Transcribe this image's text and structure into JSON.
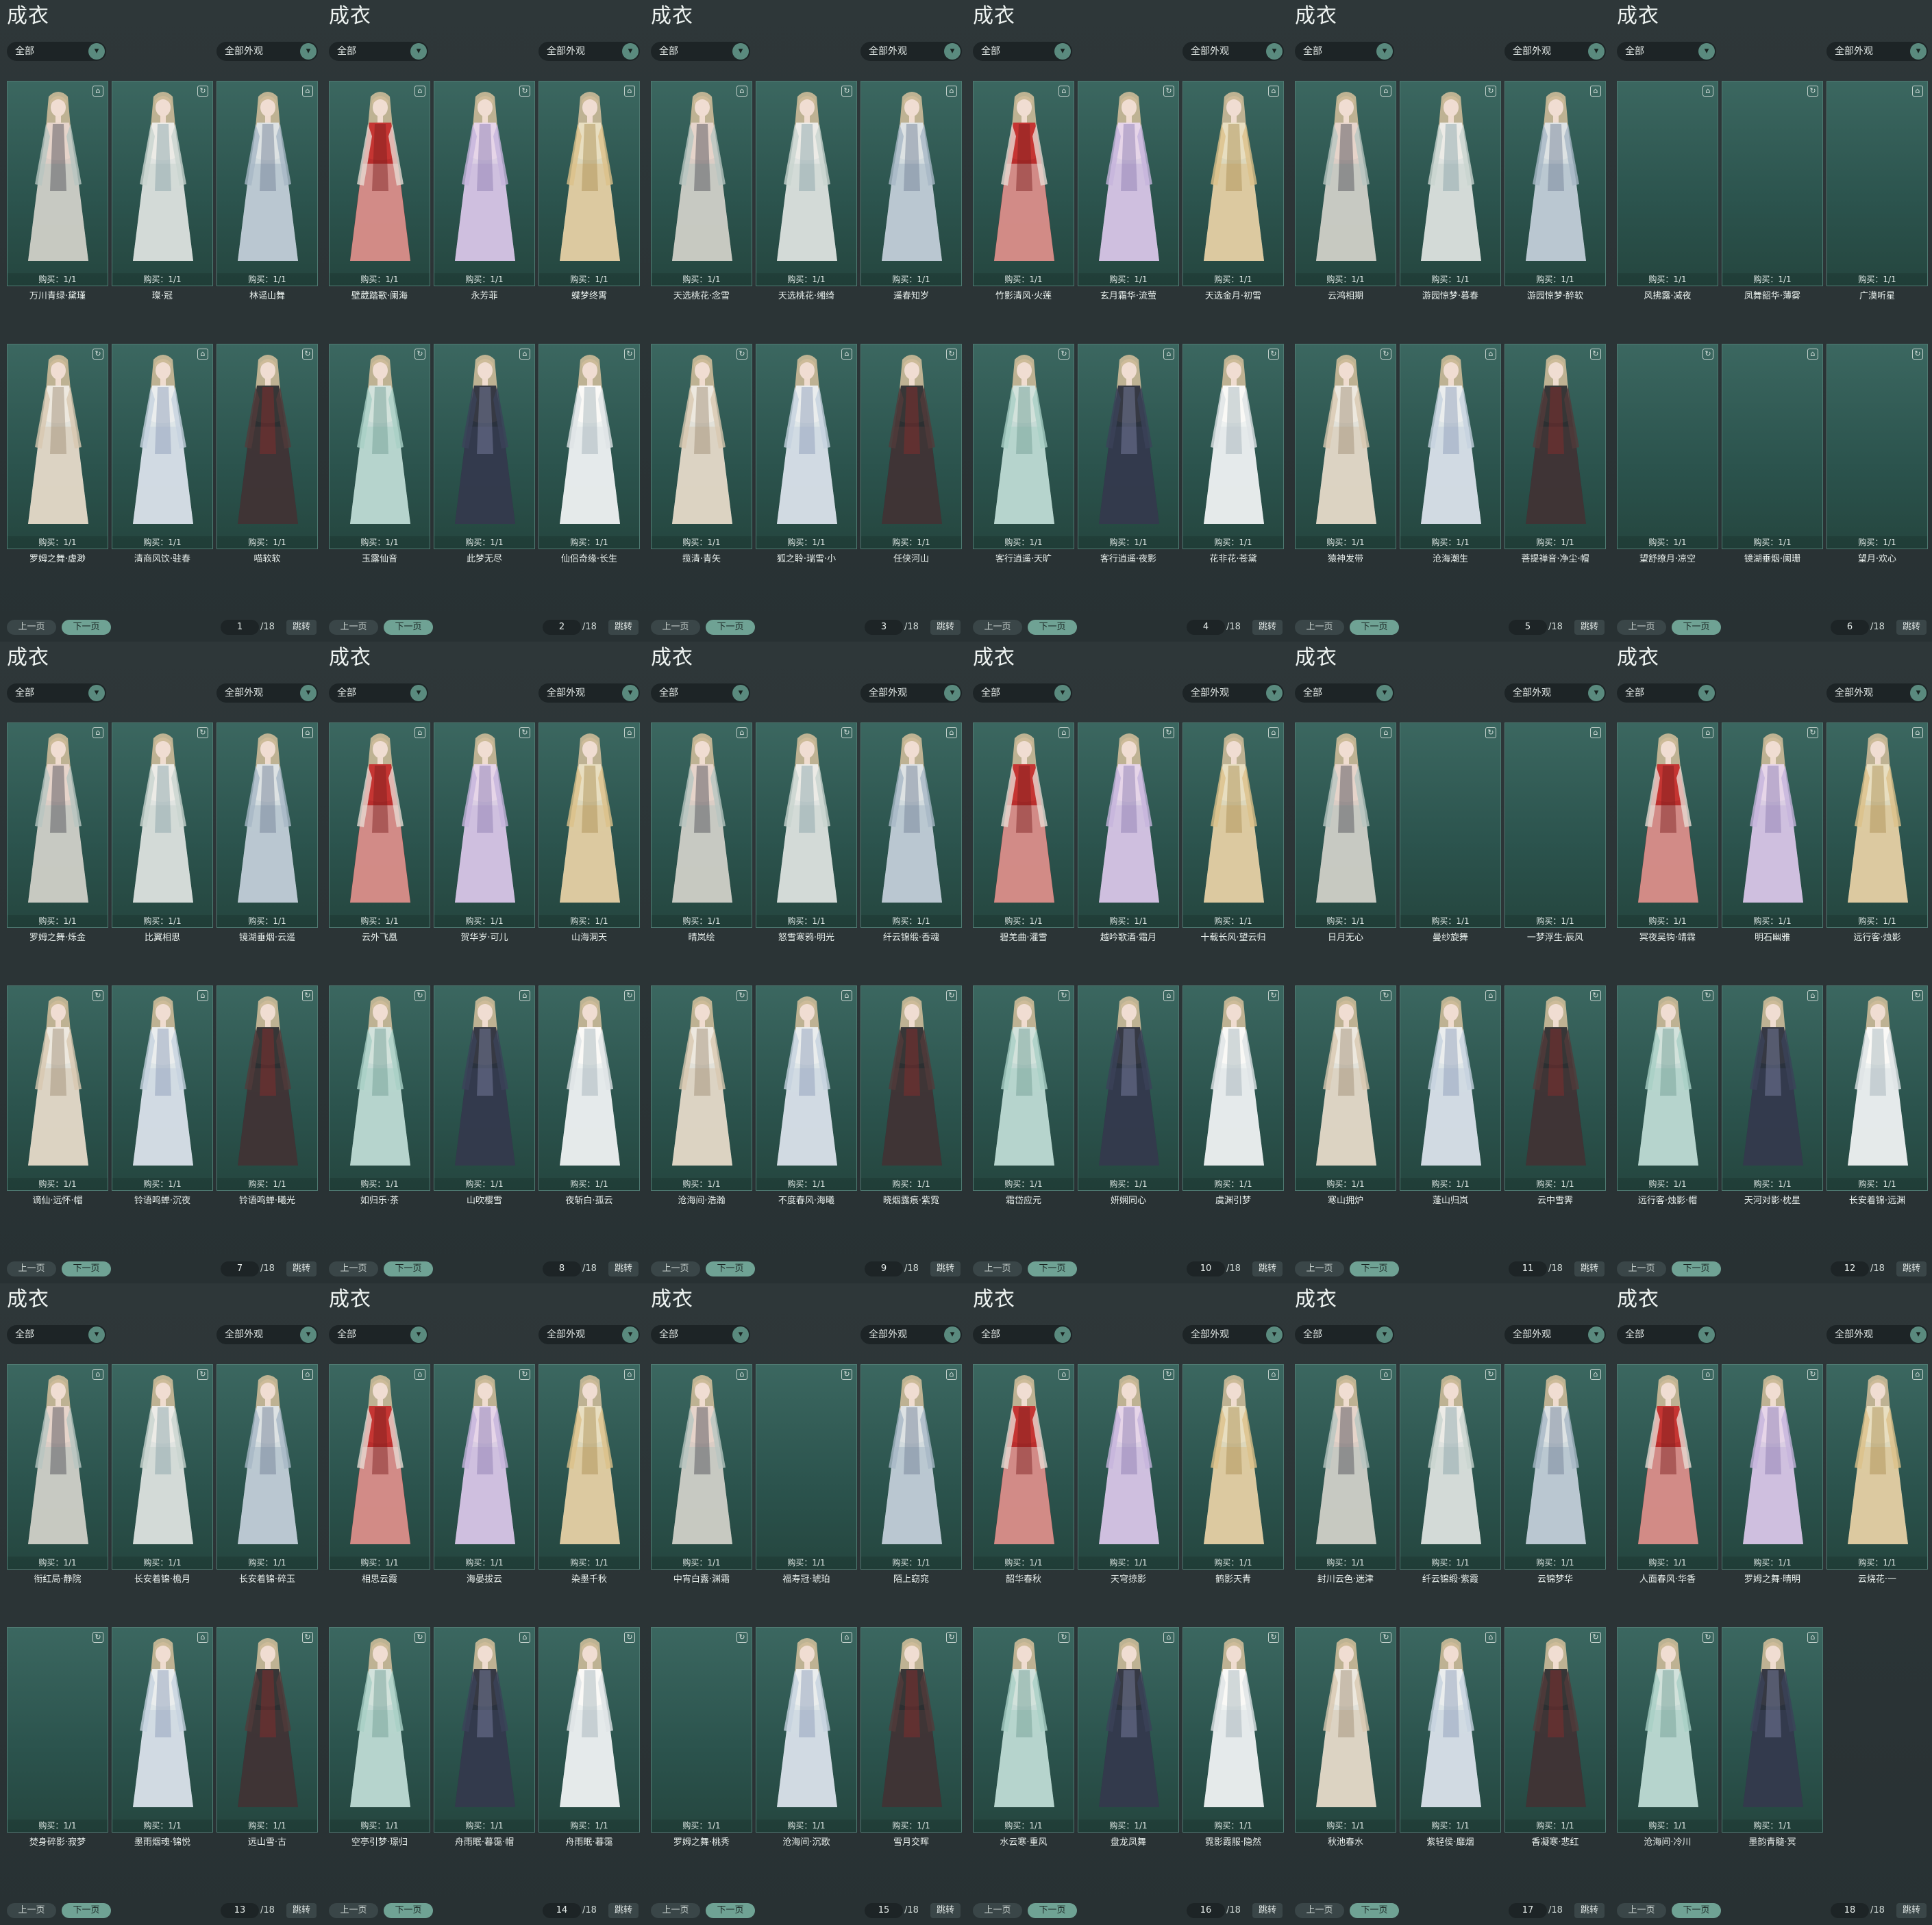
{
  "ui": {
    "title": "成衣",
    "filter_left": "全部",
    "filter_right": "全部外观",
    "prev_label": "上一页",
    "next_label": "下一页",
    "total_pages": "/18",
    "jump_label": "跳转",
    "buy_label": "购买：1/1"
  },
  "colors": {
    "background": "#2b3336",
    "card": "#2f5a54",
    "accent": "#6fa294"
  },
  "pages": [
    {
      "page": "1",
      "items": [
        "万川青绿·黛瑾",
        "璨·冠",
        "林谣山舞",
        "罗姆之舞·虚渺",
        "清商风饮·驻春",
        "喵软软"
      ]
    },
    {
      "page": "2",
      "items": [
        "壁葳踏歌·阑海",
        "永芳菲",
        "蝶梦终霄",
        "玉露仙音",
        "此梦无尽",
        "仙侣奇缘·长生"
      ]
    },
    {
      "page": "3",
      "items": [
        "天选桃花·念雪",
        "天选桃花·缃绮",
        "遥春知岁",
        "揽清·青矢",
        "狐之聆·瑞雪·小",
        "任侠河山"
      ]
    },
    {
      "page": "4",
      "items": [
        "竹影清风·火莲",
        "玄月霜华·流萤",
        "天选金月·初雪",
        "客行逍遥·天旷",
        "客行逍遥·夜影",
        "花非花·苍黛"
      ]
    },
    {
      "page": "5",
      "items": [
        "云鸿相期",
        "游园惊梦·暮春",
        "游园惊梦·醉软",
        "猿神发带",
        "沧海潮生",
        "菩提禅音·净尘·帽"
      ]
    },
    {
      "page": "6",
      "items": [
        "风拂露·减夜",
        "凤舞韶华·薄雾",
        "广漠听星",
        "望舒撩月·凉空",
        "镜湖垂烟·阑珊",
        "望月·欢心"
      ]
    },
    {
      "page": "7",
      "items": [
        "罗姆之舞·烁金",
        "比翼相思",
        "镜湖垂烟·云遥",
        "谪仙·远怀·帽",
        "铃语鸣蝉·沉夜",
        "铃语鸣蝉·曦光"
      ]
    },
    {
      "page": "8",
      "items": [
        "云外飞凰",
        "贺华岁·可儿",
        "山海洞天",
        "如归乐·茶",
        "山吹樱雪",
        "夜斩白·孤云"
      ]
    },
    {
      "page": "9",
      "items": [
        "晴岚绘",
        "怒雪寒鸦·明光",
        "纤云锦缎·香魂",
        "沧海间·浩瀚",
        "不度春风·海曦",
        "晓烟露痕·紫霓"
      ]
    },
    {
      "page": "10",
      "items": [
        "碧羌曲·灌雪",
        "越吟歌酒·霜月",
        "十载长风·望云归",
        "霜岱应元",
        "妍娴同心",
        "虞渊引梦"
      ]
    },
    {
      "page": "11",
      "items": [
        "日月无心",
        "曼纱旋舞",
        "一梦浮生·辰风",
        "寒山拥炉",
        "蓬山归岚",
        "云中雪霁"
      ]
    },
    {
      "page": "12",
      "items": [
        "冥夜吴钩·靖霖",
        "明石幽雅",
        "远行客·烛影",
        "远行客·烛影·帽",
        "天河对影·枕星",
        "长安着锦·远渊"
      ]
    },
    {
      "page": "13",
      "items": [
        "衔红局·静院",
        "长安着锦·檐月",
        "长安着锦·碎玉",
        "焚身碎影·寂梦",
        "墨雨烟魂·锦悦",
        "远山雪·古"
      ]
    },
    {
      "page": "14",
      "items": [
        "相思云霞",
        "海晏拔云",
        "染墨千秋",
        "空亭引梦·璟归",
        "舟雨眠·暮霭·帽",
        "舟雨眠·暮霭"
      ]
    },
    {
      "page": "15",
      "items": [
        "中宵白露·渊霜",
        "福寿冠·琥珀",
        "陌上窈窕",
        "罗姆之舞·桃秀",
        "沧海间·沉歌",
        "雪月交晖"
      ]
    },
    {
      "page": "16",
      "items": [
        "韶华春秋",
        "天穹掠影",
        "鹤影天青",
        "水云寒·重风",
        "盘龙凤舞",
        "霓影霞服·隐然"
      ]
    },
    {
      "page": "17",
      "items": [
        "封川云色·迷津",
        "纤云锦缎·紫霞",
        "云锦梦华",
        "秋池春水",
        "紫轻侯·靡烟",
        "香凝寒·悲红"
      ]
    },
    {
      "page": "18",
      "items": [
        "人面春风·华香",
        "罗姆之舞·晴明",
        "云烧花·一",
        "沧海间·冷川",
        "墨韵青髓·冥"
      ]
    }
  ]
}
